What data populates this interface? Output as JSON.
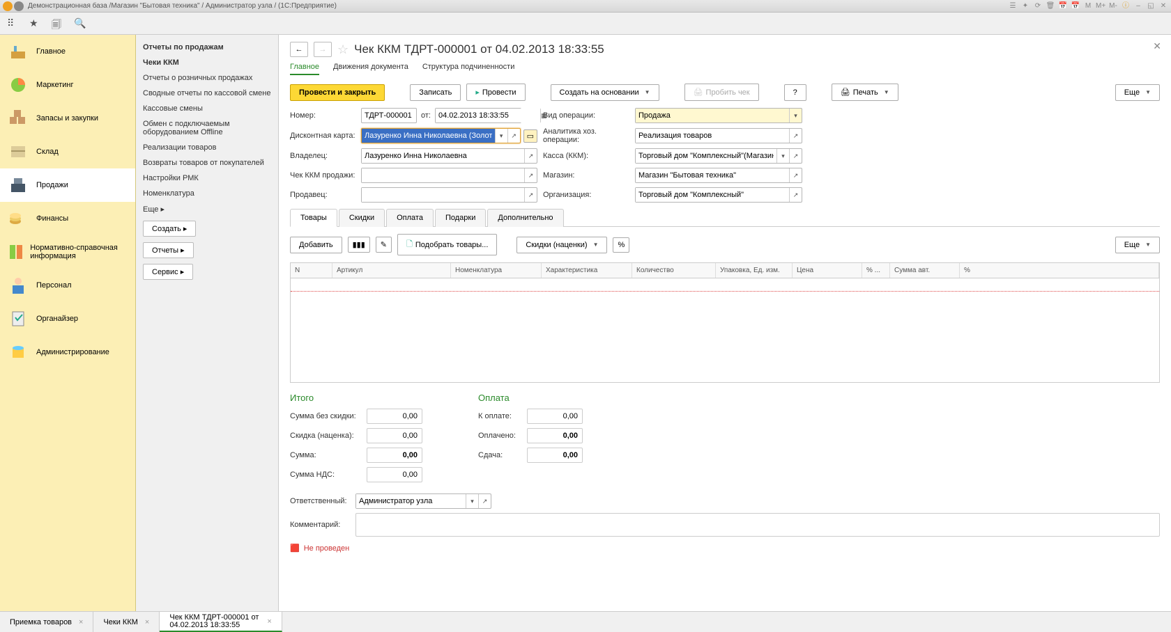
{
  "window_title": "Демонстрационная база /Магазин \"Бытовая техника\" / Администратор узла / (1С:Предприятие)",
  "leftnav": [
    {
      "label": "Главное"
    },
    {
      "label": "Маркетинг"
    },
    {
      "label": "Запасы и закупки"
    },
    {
      "label": "Склад"
    },
    {
      "label": "Продажи"
    },
    {
      "label": "Финансы"
    },
    {
      "label": "Нормативно-справочная информация"
    },
    {
      "label": "Персонал"
    },
    {
      "label": "Органайзер"
    },
    {
      "label": "Администрирование"
    }
  ],
  "subnav": {
    "head": "Отчеты по продажам",
    "items": [
      "Чеки ККМ",
      "Отчеты о розничных продажах",
      "Сводные отчеты по кассовой смене",
      "Кассовые смены",
      "Обмен с подключаемым оборудованием Offline",
      "Реализации товаров",
      "Возвраты товаров от покупателей",
      "Настройки РМК",
      "Номенклатура"
    ],
    "more": "Еще ▸",
    "buttons": [
      "Создать ▸",
      "Отчеты ▸",
      "Сервис ▸"
    ]
  },
  "doc": {
    "title": "Чек ККМ ТДРТ-000001 от 04.02.2013 18:33:55",
    "tabs": [
      "Главное",
      "Движения документа",
      "Структура подчиненности"
    ],
    "toolbar": {
      "primary": "Провести и закрыть",
      "save": "Записать",
      "post": "Провести",
      "createbase": "Создать на основании",
      "punch": "Пробить чек",
      "help": "?",
      "print": "Печать",
      "more": "Еще"
    },
    "fields": {
      "number_lbl": "Номер:",
      "number": "ТДРТ-000001",
      "from_lbl": "от:",
      "date": "04.02.2013 18:33:55",
      "op_lbl": "Вид операции:",
      "op": "Продажа",
      "discount_lbl": "Дисконтная карта:",
      "discount": "Лазуренко Инна Николаевна (Золотая)",
      "analytics_lbl": "Аналитика хоз. операции:",
      "analytics": "Реализация товаров",
      "owner_lbl": "Владелец:",
      "owner": "Лазуренко Инна Николаевна",
      "kassa_lbl": "Касса (ККМ):",
      "kassa": "Торговый дом \"Комплексный\"(Магазин \"Бы",
      "salecheck_lbl": "Чек ККМ продажи:",
      "salecheck": "",
      "shop_lbl": "Магазин:",
      "shop": "Магазин \"Бытовая техника\"",
      "seller_lbl": "Продавец:",
      "seller": "",
      "org_lbl": "Организация:",
      "org": "Торговый дом \"Комплексный\""
    },
    "subtabs": [
      "Товары",
      "Скидки",
      "Оплата",
      "Подарки",
      "Дополнительно"
    ],
    "tabletools": {
      "add": "Добавить",
      "pick": "Подобрать товары...",
      "discounts": "Скидки (наценки)",
      "more": "Еще"
    },
    "columns": [
      "N",
      "Артикул",
      "Номенклатура",
      "Характеристика",
      "Количество",
      "Упаковка, Ед. изм.",
      "Цена",
      "% ...",
      "Сумма авт.",
      "%"
    ],
    "totals": {
      "h1": "Итого",
      "h2": "Оплата",
      "sum_no_disc_lbl": "Сумма без скидки:",
      "sum_no_disc": "0,00",
      "disc_lbl": "Скидка (наценка):",
      "disc": "0,00",
      "sum_lbl": "Сумма:",
      "sum": "0,00",
      "vat_lbl": "Сумма НДС:",
      "vat": "0,00",
      "topay_lbl": "К оплате:",
      "topay": "0,00",
      "paid_lbl": "Оплачено:",
      "paid": "0,00",
      "change_lbl": "Сдача:",
      "change": "0,00"
    },
    "resp_lbl": "Ответственный:",
    "resp": "Администратор узла",
    "comment_lbl": "Комментарий:",
    "status": "Не проведен"
  },
  "bottomtabs": [
    "Приемка товаров",
    "Чеки ККМ",
    "Чек ККМ ТДРТ-000001 от 04.02.2013 18:33:55"
  ]
}
